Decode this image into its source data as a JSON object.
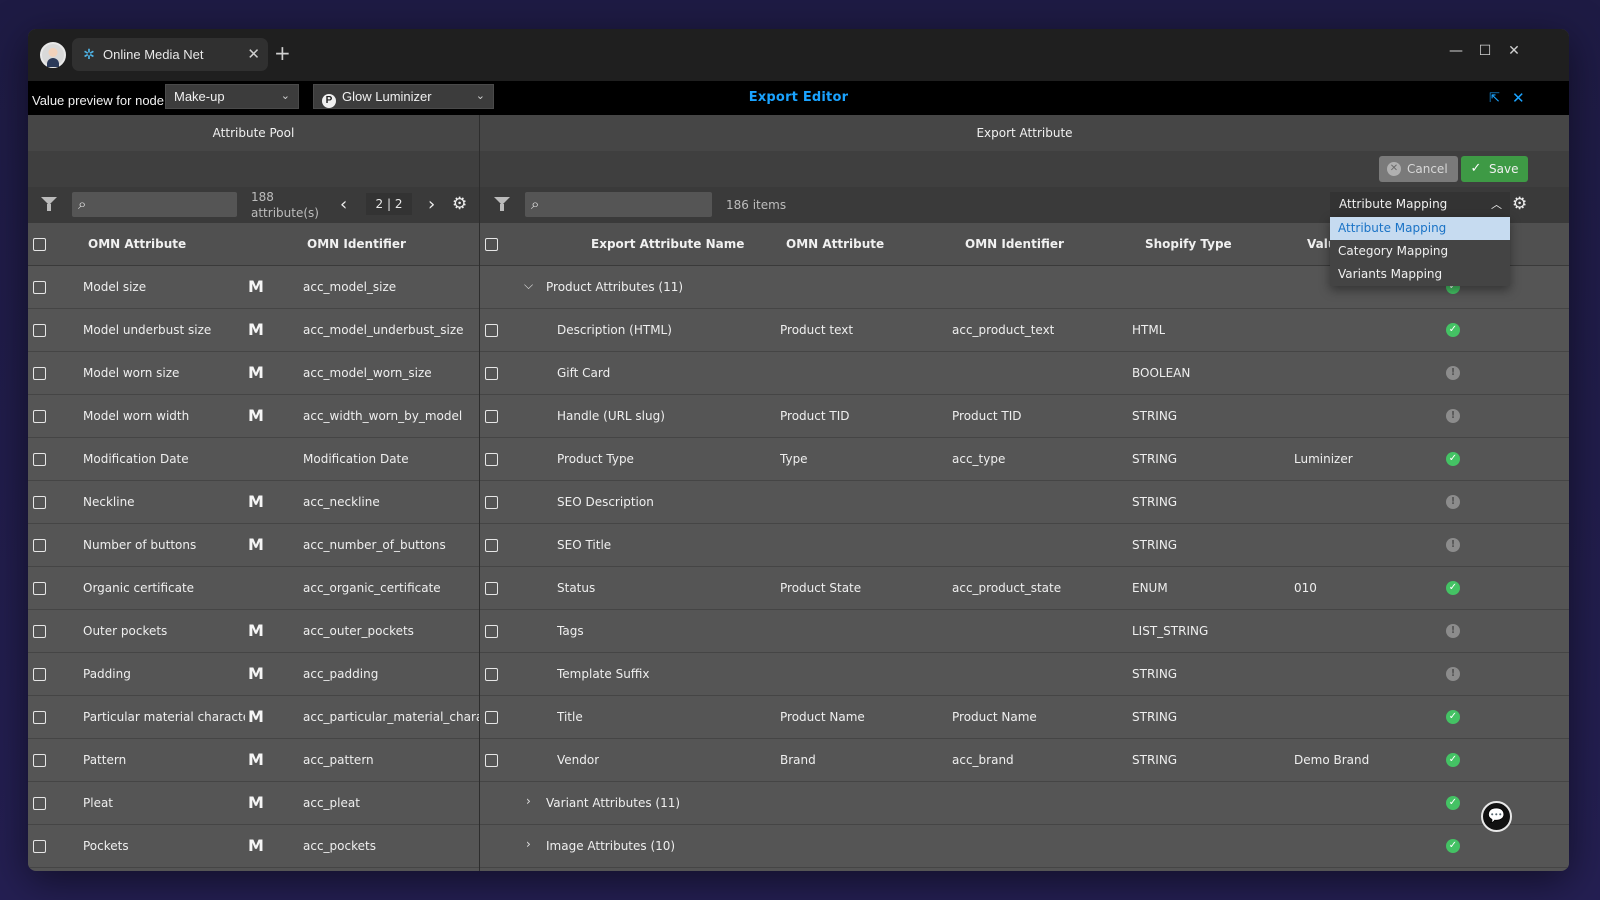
{
  "browser": {
    "tab_title": "Online Media Net",
    "tab_close": "✕",
    "new_tab": "+",
    "minimize": "—",
    "maximize": "☐",
    "close": "✕"
  },
  "editor": {
    "value_preview_label": "Value preview for node",
    "node_select": "Make-up",
    "product_select": "Glow Luminizer",
    "product_badge": "P",
    "title": "Export Editor",
    "accent": "#1aa3ff"
  },
  "left_panel": {
    "title": "Attribute Pool",
    "search_placeholder": "",
    "count_label": "188 attribute(s)",
    "page_indicator": "2 | 2",
    "prev": "‹",
    "next": "›",
    "columns": {
      "attribute": "OMN Attribute",
      "identifier": "OMN Identifier"
    },
    "rows": [
      {
        "attribute": "Model size",
        "m": "M",
        "identifier": "acc_model_size"
      },
      {
        "attribute": "Model underbust size",
        "m": "M",
        "identifier": "acc_model_underbust_size"
      },
      {
        "attribute": "Model worn size",
        "m": "M",
        "identifier": "acc_model_worn_size"
      },
      {
        "attribute": "Model worn width",
        "m": "M",
        "identifier": "acc_width_worn_by_model"
      },
      {
        "attribute": "Modification Date",
        "m": "",
        "identifier": "Modification Date"
      },
      {
        "attribute": "Neckline",
        "m": "M",
        "identifier": "acc_neckline"
      },
      {
        "attribute": "Number of buttons",
        "m": "M",
        "identifier": "acc_number_of_buttons"
      },
      {
        "attribute": "Organic certificate",
        "m": "",
        "identifier": "acc_organic_certificate"
      },
      {
        "attribute": "Outer pockets",
        "m": "M",
        "identifier": "acc_outer_pockets"
      },
      {
        "attribute": "Padding",
        "m": "M",
        "identifier": "acc_padding"
      },
      {
        "attribute": "Particular material characte...",
        "m": "M",
        "identifier": "acc_particular_material_charact..."
      },
      {
        "attribute": "Pattern",
        "m": "M",
        "identifier": "acc_pattern"
      },
      {
        "attribute": "Pleat",
        "m": "M",
        "identifier": "acc_pleat"
      },
      {
        "attribute": "Pockets",
        "m": "M",
        "identifier": "acc_pockets"
      }
    ]
  },
  "right_panel": {
    "title": "Export Attribute",
    "cancel_label": "Cancel",
    "save_label": "Save",
    "search_placeholder": "",
    "items_count": "186 items",
    "mapping_select": "Attribute Mapping",
    "mapping_options": [
      "Attribute Mapping",
      "Category Mapping",
      "Variants Mapping"
    ],
    "columns": {
      "name": "Export Attribute Name",
      "omn_attribute": "OMN Attribute",
      "omn_identifier": "OMN Identifier",
      "shopify_type": "Shopify Type",
      "value": "Valu"
    },
    "group_product": "Product Attributes (11)",
    "group_variant": "Variant Attributes (11)",
    "group_image": "Image Attributes (10)",
    "rows": [
      {
        "name": "Description (HTML)",
        "omn_attribute": "Product text",
        "omn_identifier": "acc_product_text",
        "type": "HTML",
        "value": "",
        "status": "ok"
      },
      {
        "name": "Gift Card",
        "omn_attribute": "",
        "omn_identifier": "",
        "type": "BOOLEAN",
        "value": "",
        "status": "info"
      },
      {
        "name": "Handle (URL slug)",
        "omn_attribute": "Product TID",
        "omn_identifier": "Product TID",
        "type": "STRING",
        "value": "",
        "status": "info"
      },
      {
        "name": "Product Type",
        "omn_attribute": "Type",
        "omn_identifier": "acc_type",
        "type": "STRING",
        "value": "Luminizer",
        "status": "ok"
      },
      {
        "name": "SEO Description",
        "omn_attribute": "",
        "omn_identifier": "",
        "type": "STRING",
        "value": "",
        "status": "info"
      },
      {
        "name": "SEO Title",
        "omn_attribute": "",
        "omn_identifier": "",
        "type": "STRING",
        "value": "",
        "status": "info"
      },
      {
        "name": "Status",
        "omn_attribute": "Product State",
        "omn_identifier": "acc_product_state",
        "type": "ENUM",
        "value": "010",
        "status": "ok"
      },
      {
        "name": "Tags",
        "omn_attribute": "",
        "omn_identifier": "",
        "type": "LIST_STRING",
        "value": "",
        "status": "info"
      },
      {
        "name": "Template Suffix",
        "omn_attribute": "",
        "omn_identifier": "",
        "type": "STRING",
        "value": "",
        "status": "info"
      },
      {
        "name": "Title",
        "omn_attribute": "Product Name",
        "omn_identifier": "Product Name",
        "type": "STRING",
        "value": "",
        "status": "ok"
      },
      {
        "name": "Vendor",
        "omn_attribute": "Brand",
        "omn_identifier": "acc_brand",
        "type": "STRING",
        "value": "Demo Brand",
        "status": "ok"
      }
    ]
  },
  "colors": {
    "ok": "#44c264",
    "save": "#3e9a45",
    "selected_option": "#c6dbf0"
  }
}
